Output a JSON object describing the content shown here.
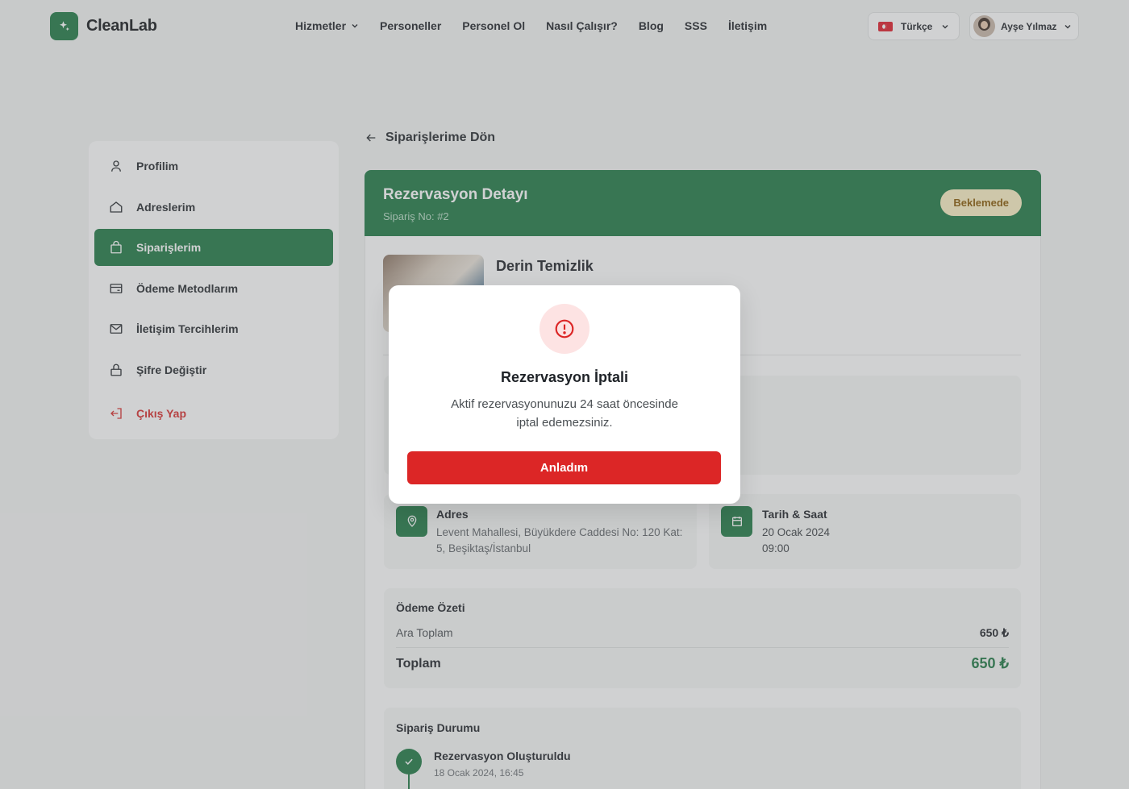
{
  "header": {
    "brand": "CleanLab",
    "nav": [
      {
        "label": "Hizmetler",
        "has_dropdown": true
      },
      {
        "label": "Personeller"
      },
      {
        "label": "Personel Ol"
      },
      {
        "label": "Nasıl Çalışır?"
      },
      {
        "label": "Blog"
      },
      {
        "label": "SSS"
      },
      {
        "label": "İletişim"
      }
    ],
    "language": "Türkçe",
    "user_name": "Ayşe Yılmaz"
  },
  "sidebar": {
    "items": [
      {
        "label": "Profilim",
        "icon": "user-icon"
      },
      {
        "label": "Adreslerim",
        "icon": "home-icon"
      },
      {
        "label": "Siparişlerim",
        "icon": "shopping-bag-icon",
        "active": true
      },
      {
        "label": "Ödeme Metodlarım",
        "icon": "credit-card-icon"
      },
      {
        "label": "İletişim Tercihlerim",
        "icon": "mail-icon"
      },
      {
        "label": "Şifre Değiştir",
        "icon": "lock-icon"
      },
      {
        "label": "Çıkış Yap",
        "icon": "logout-icon"
      }
    ]
  },
  "main": {
    "back_label": "Siparişlerime Dön",
    "card_title": "Rezervasyon Detayı",
    "order_no": "Sipariş No: #2",
    "status_badge": "Beklemede",
    "service_name": "Derin Temizlik",
    "address": {
      "title": "Adres",
      "line1": "Levent Mahallesi, Büyükdere Caddesi No: 120 Kat:",
      "line2": "5, Beşiktaş/İstanbul"
    },
    "datetime": {
      "title": "Tarih & Saat",
      "date": "20 Ocak 2024",
      "time": "09:00"
    },
    "payment": {
      "title": "Ödeme Özeti",
      "subtotal_label": "Ara Toplam",
      "subtotal_value": "650 ₺",
      "total_label": "Toplam",
      "total_value": "650 ₺"
    },
    "order_status": {
      "title": "Sipariş Durumu",
      "steps": [
        {
          "label": "Rezervasyon Oluşturuldu",
          "date": "18 Ocak 2024, 16:45"
        }
      ]
    }
  },
  "modal": {
    "title": "Rezervasyon İptali",
    "text_line1": "Aktif rezervasyonunuzu 24 saat öncesinde",
    "text_line2": "iptal edemezsiniz.",
    "button": "Anladım"
  },
  "colors": {
    "brand_green": "#1f7a45",
    "danger_red": "#dc2626",
    "badge_bg": "#fdf1c4",
    "badge_text": "#8a5a05"
  }
}
